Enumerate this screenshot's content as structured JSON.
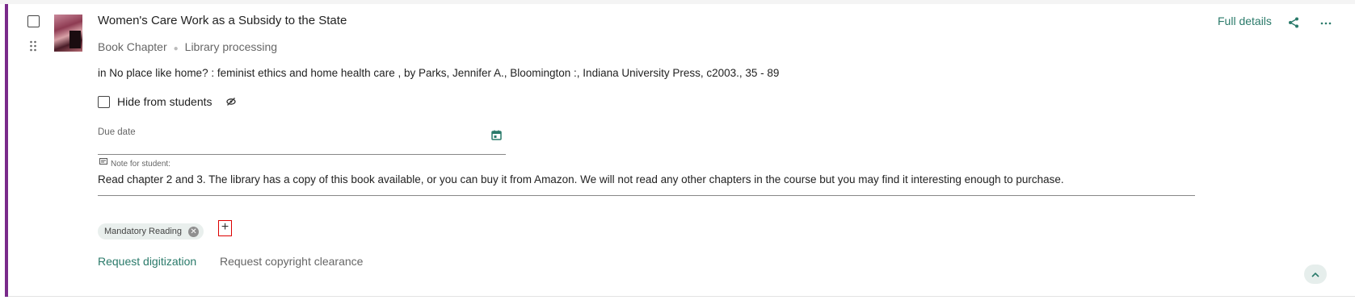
{
  "item": {
    "title": "Women's Care Work as a Subsidy to the State",
    "type": "Book Chapter",
    "status": "Library processing",
    "citation": "in No place like home? : feminist ethics and home health care , by Parks, Jennifer A., Bloomington :, Indiana University Press, c2003., 35 - 89",
    "full_details_label": "Full details"
  },
  "visibility": {
    "hide_label": "Hide from students"
  },
  "due_date": {
    "label": "Due date",
    "value": ""
  },
  "note": {
    "label": "Note for student:",
    "text": "Read chapter 2 and 3. The library has a copy of this book available, or you can buy it from Amazon. We will not read any other chapters in the course but you may find it interesting enough to purchase."
  },
  "tags": [
    {
      "label": "Mandatory Reading"
    }
  ],
  "add_tag_symbol": "+",
  "actions": {
    "request_digitization": "Request digitization",
    "request_copyright": "Request copyright clearance"
  },
  "colors": {
    "accent": "#7a2a8a",
    "link": "#2a7a6a",
    "highlight_border": "#dd0000"
  },
  "icons": [
    "drag-handle-icon",
    "eye-off-icon",
    "calendar-icon",
    "note-icon",
    "share-icon",
    "more-horizontal-icon",
    "chevron-up-icon",
    "remove-tag-icon"
  ]
}
